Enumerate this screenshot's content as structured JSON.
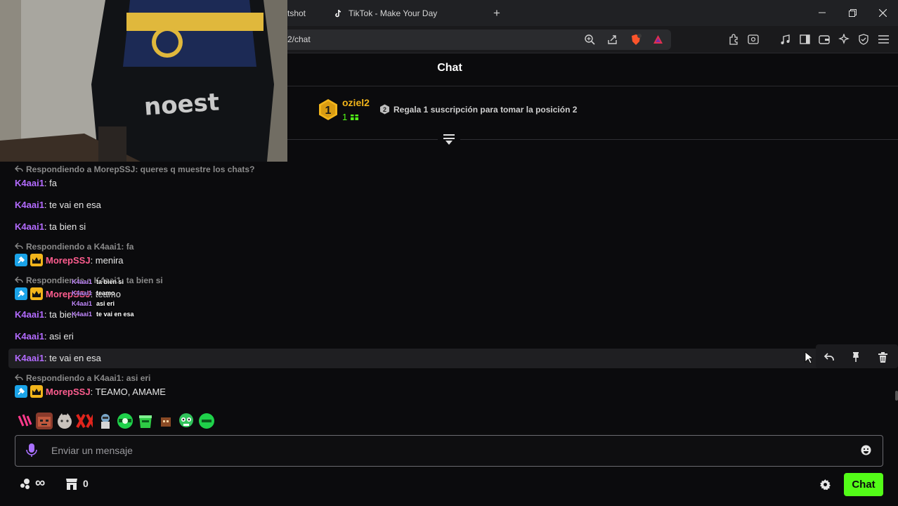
{
  "browser": {
    "tabs": [
      {
        "label": "tshot"
      },
      {
        "label": "TikTok - Make Your Day"
      }
    ],
    "new_tab_label": "+",
    "url": "2/chat"
  },
  "chat": {
    "title": "Chat",
    "leaderboard": {
      "rank_badge": "1",
      "user": "oziel2",
      "gift_count": "1",
      "slot_badge": "2",
      "cta": "Regala 1 suscripción para tomar la posición 2"
    },
    "messages": [
      {
        "type": "reply",
        "text": "Respondiendo a MorepSSJ: queres q muestre los chats?"
      },
      {
        "type": "msg",
        "user": "K4aai1",
        "color": "purple",
        "text": ": fa"
      },
      {
        "type": "msg",
        "user": "K4aai1",
        "color": "purple",
        "text": ": te vai en esa"
      },
      {
        "type": "msg",
        "user": "K4aai1",
        "color": "purple",
        "text": ": ta bien si"
      },
      {
        "type": "reply",
        "text": "Respondiendo a K4aai1: fa"
      },
      {
        "type": "msg",
        "user": "MorepSSJ",
        "color": "pink",
        "badges": true,
        "text": ": menira"
      },
      {
        "type": "reply",
        "text": "Respondiendo a K4aai1: ta bien si"
      },
      {
        "type": "msg",
        "user": "MorepSSJ",
        "color": "pink",
        "badges": true,
        "text": ": teamo"
      },
      {
        "type": "msg",
        "user": "K4aai1",
        "color": "purple",
        "text": ": ta bien"
      },
      {
        "type": "msg",
        "user": "K4aai1",
        "color": "purple",
        "text": ": asi eri"
      },
      {
        "type": "msg",
        "user": "K4aai1",
        "color": "purple",
        "text": ": te vai en esa"
      },
      {
        "type": "reply",
        "text": "Respondiendo a K4aai1: asi eri"
      },
      {
        "type": "msg",
        "user": "MorepSSJ",
        "color": "pink",
        "badges": true,
        "text": ": TEAMO, AMAME"
      }
    ],
    "overlay": [
      {
        "user": "K4aai1",
        "text": "ta bien si"
      },
      {
        "user": "K4aai1",
        "text": "teamo"
      },
      {
        "user": "K4aai1",
        "text": "asi eri"
      },
      {
        "user": "K4aai1",
        "text": "te vai en esa"
      }
    ],
    "input_placeholder": "Enviar un mensaje",
    "footer": {
      "infinity": "∞",
      "store_count": "0",
      "chat_button": "Chat"
    }
  },
  "colors": {
    "accent": "#53fc18",
    "username_purple": "#b36bff",
    "username_pink": "#ff5d8f",
    "gold": "#f2b51b"
  }
}
